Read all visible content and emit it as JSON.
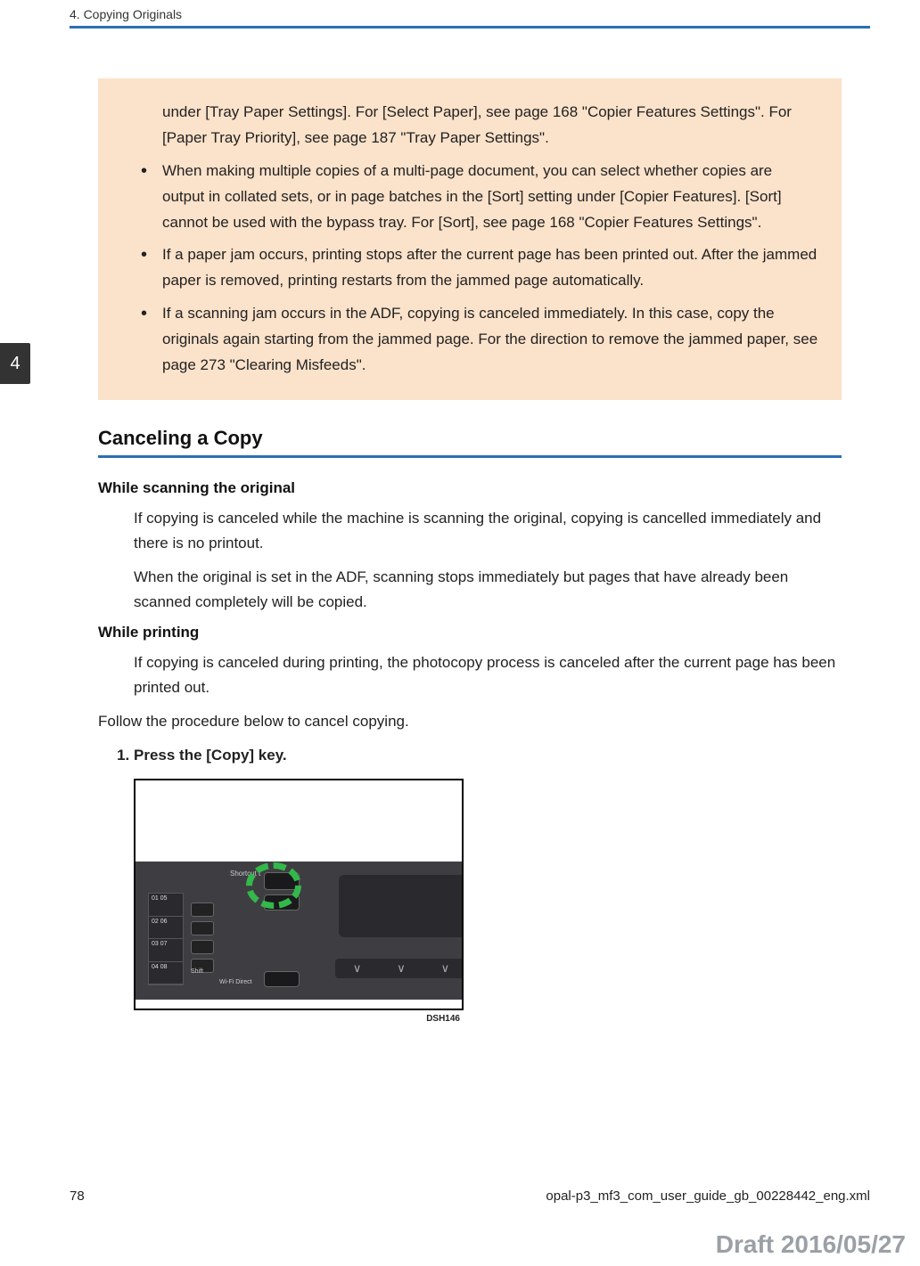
{
  "header": {
    "chapter_line": "4. Copying Originals"
  },
  "tab": {
    "number": "4"
  },
  "peach": {
    "continuation": "under [Tray Paper Settings]. For [Select Paper], see page 168 \"Copier Features Settings\". For [Paper Tray Priority], see page 187 \"Tray Paper Settings\".",
    "items": [
      "When making multiple copies of a multi-page document, you can select whether copies are output in collated sets, or in page batches in the [Sort] setting under [Copier Features]. [Sort] cannot be used with the bypass tray. For [Sort], see page 168 \"Copier Features Settings\".",
      "If a paper jam occurs, printing stops after the current page has been printed out. After the jammed paper is removed, printing restarts from the jammed page automatically.",
      "If a scanning jam occurs in the ADF, copying is canceled immediately. In this case, copy the originals again starting from the jammed page. For the direction to remove the jammed paper, see page 273 \"Clearing Misfeeds\"."
    ]
  },
  "section": {
    "title": "Canceling a Copy",
    "sub1": {
      "heading": "While scanning the original",
      "p1": "If copying is canceled while the machine is scanning the original, copying is cancelled immediately and there is no printout.",
      "p2": "When the original is set in the ADF, scanning stops immediately but pages that have already been scanned completely will be copied."
    },
    "sub2": {
      "heading": "While printing",
      "p1": "If copying is canceled during printing, the photocopy process is canceled after the current page has been printed out."
    },
    "follow": "Follow the procedure below to cancel copying.",
    "step1": "Press the [Copy] key."
  },
  "figure": {
    "nums": [
      "01\n05",
      "02\n06",
      "03\n07",
      "04\n08"
    ],
    "shift": "Shift",
    "shortcut": "Shortcut t",
    "wifi": "Wi-Fi Direct",
    "caption": "DSH146"
  },
  "footer": {
    "page": "78",
    "filename": "opal-p3_mf3_com_user_guide_gb_00228442_eng.xml"
  },
  "draft": "Draft 2016/05/27"
}
